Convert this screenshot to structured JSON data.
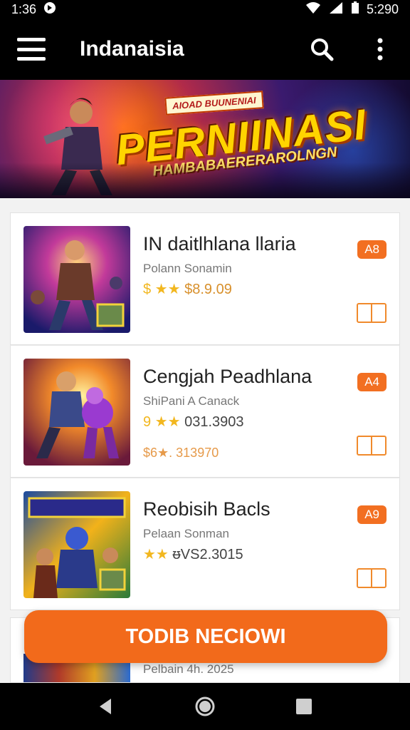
{
  "status_bar": {
    "time": "1:36",
    "notification_icon": "notification-icon",
    "battery": "5:290"
  },
  "app_bar": {
    "title": "Indanaisia",
    "menu_icon": "hamburger-menu-icon",
    "search_icon": "search-icon",
    "more_icon": "more-vert-icon"
  },
  "banner": {
    "badge": "AIOAD BUUNENIAI",
    "title": "PERNIINASI",
    "subtitle": "HAMBABAERERAROLNGN"
  },
  "games": [
    {
      "title": "IN daitlhlana llaria",
      "subtitle": "Polann Sonamin",
      "stars": "$ ★★",
      "price": "$8.9.09",
      "age": "A8",
      "extra": ""
    },
    {
      "title": "Cengjah Peadhlana",
      "subtitle": "ShiPani A Canack",
      "stars": "9 ★★",
      "price": "031.3903",
      "age": "A4",
      "extra": "$6★. 313970"
    },
    {
      "title": "Reobisih Bacls",
      "subtitle": "Pelaan Sonman",
      "stars": "★★",
      "price": "ᵿVS2.3015",
      "age": "A9",
      "extra": ""
    }
  ],
  "partial_item": {
    "subtitle": "Pelbain 4h. 2025"
  },
  "cta": {
    "label": "TODIB NECIOWI"
  },
  "nav": {
    "back_icon": "back-triangle-icon",
    "home_icon": "home-circle-icon",
    "recents_icon": "recents-square-icon"
  },
  "colors": {
    "accent": "#f26a1b",
    "bar": "#000000",
    "star": "#f2b71f"
  }
}
